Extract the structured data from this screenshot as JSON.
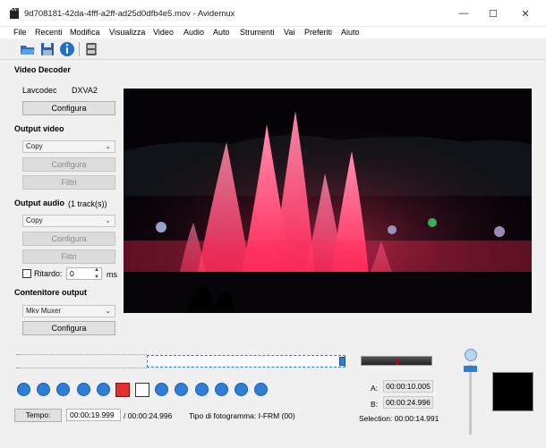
{
  "window": {
    "title": "9d708181-42da-4fff-a2ff-ad25d0dfb4e5.mov - Avidemux",
    "minimize": "—",
    "maximize": "☐",
    "close": "✕"
  },
  "menu": [
    "File",
    "Recenti",
    "Modifica",
    "Visualizza",
    "Video",
    "Audio",
    "Auto",
    "Strumenti",
    "Vai",
    "Preferiti",
    "Aiuto"
  ],
  "toolbar": {
    "icons": [
      "open-folder-icon",
      "save-disk-icon",
      "info-icon",
      "film-properties-icon"
    ]
  },
  "video_decoder": {
    "heading": "Video Decoder",
    "codec": "Lavcodec",
    "hw": "DXVA2",
    "configure": "Configura"
  },
  "output_video": {
    "heading": "Output video",
    "codec": "Copy",
    "configure": "Configura",
    "filters": "Filtri"
  },
  "output_audio": {
    "heading": "Output audio",
    "tracks": "(1 track(s))",
    "codec": "Copy",
    "configure": "Configura",
    "filters": "Filtri",
    "delay_label": "Ritardo:",
    "delay_value": "0",
    "delay_unit": "ms",
    "delay_checked": false
  },
  "container": {
    "heading": "Contenitore output",
    "muxer": "Mkv Muxer",
    "configure": "Configura"
  },
  "timeline": {
    "position": 0.8
  },
  "status": {
    "time_button": "Tempo:",
    "current_time": "00:00:19.999",
    "total_time": "/ 00:00:24.996",
    "frame_type": "Tipo di fotogramma:  I-FRM (00)"
  },
  "selection": {
    "a_label": "A:",
    "a_value": "00:00:10.005",
    "b_label": "B:",
    "b_value": "00:00:24.996",
    "selection_text": "Selection: 00:00:14.991"
  },
  "colors": {
    "accent": "#2e7ed8",
    "marker_red": "#cc0000",
    "fountain": "#ff2a5a"
  }
}
